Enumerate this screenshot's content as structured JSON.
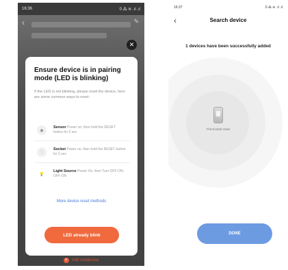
{
  "left_screen": {
    "status_time": "16:36",
    "status_right": "0 ⁂ ≋ .ıl .ıl",
    "modal": {
      "title": "Ensure device is in pairing mode (LED is blinking)",
      "description": "If the LED is not blinking, please reset the device, here are some common ways to reset:",
      "methods": [
        {
          "name": "Sensor",
          "detail": "Power on, then hold the RESET button for 5 sec",
          "icon": "sensor-icon"
        },
        {
          "name": "Socket",
          "detail": "Power on, then hold the RESET button for 5 sec",
          "icon": "socket-icon"
        },
        {
          "name": "Light Source",
          "detail": "Power On, then Turn OFF-ON-OFF-ON",
          "icon": "bulb-icon"
        }
      ],
      "more_link": "More device reset methods",
      "confirm_button": "LED already blink"
    },
    "add_subdevice_label": "Add subdevice"
  },
  "right_screen": {
    "status_time": "16:37",
    "status_right": "0 ⁂ ≋ .ıl .ıl",
    "title": "Search device",
    "success_message": "1 devices have been successfully added",
    "device_name": "Thermostat Valve",
    "done_button": "DONE"
  },
  "colors": {
    "led_button": "#f06a3e",
    "done_button": "#6d9be2",
    "link": "#4a78d6"
  }
}
